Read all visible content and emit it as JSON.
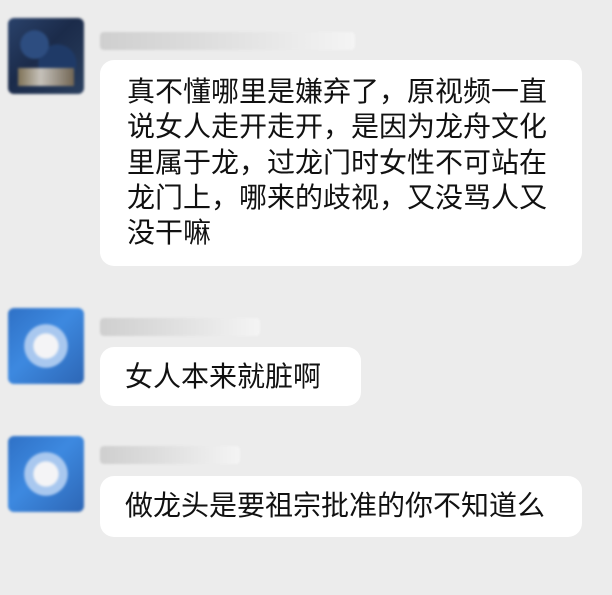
{
  "messages": [
    {
      "name": "",
      "text": "真不懂哪里是嫌弃了，原视频一直说女人走开走开，是因为龙舟文化里属于龙，过龙门时女性不可站在龙门上，哪来的歧视，又没骂人又没干嘛"
    },
    {
      "name": "",
      "text": "女人本来就脏啊"
    },
    {
      "name": "",
      "text": "做龙头是要祖宗批准的你不知道么"
    }
  ]
}
